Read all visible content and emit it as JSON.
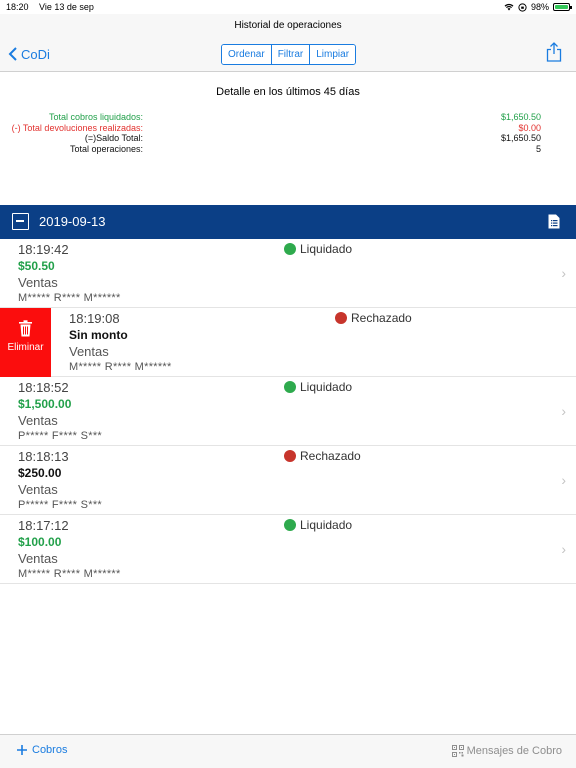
{
  "status_bar": {
    "time": "18:20",
    "date": "Vie 13 de sep",
    "battery": "98%"
  },
  "nav": {
    "title": "Historial de operaciones",
    "back_label": "CoDi",
    "segments": [
      "Ordenar",
      "Filtrar",
      "Limpiar"
    ]
  },
  "summary": {
    "title": "Detalle en los últimos 45 días",
    "rows": [
      {
        "label": "Total cobros liquidados:",
        "value": "$1,650.50",
        "color": "#22a04a"
      },
      {
        "label": "(-) Total devoluciones realizadas:",
        "value": "$0.00",
        "color": "#e2322f"
      },
      {
        "label": "(=)Saldo Total:",
        "value": "$1,650.50",
        "color": "#111111"
      },
      {
        "label": "Total operaciones:",
        "value": "5",
        "color": "#111111"
      }
    ]
  },
  "section": {
    "date": "2019-09-13"
  },
  "operations": [
    {
      "time": "18:19:42",
      "amount": "$50.50",
      "amount_color": "#22a04a",
      "concept": "Ventas",
      "client": "M***** R**** M******",
      "status": "Liquidado",
      "status_type": "ok"
    },
    {
      "time": "18:19:08",
      "amount": "Sin monto",
      "amount_color": "#111111",
      "concept": "Ventas",
      "client": "M***** R**** M******",
      "status": "Rechazado",
      "status_type": "bad",
      "swiped": true
    },
    {
      "time": "18:18:52",
      "amount": "$1,500.00",
      "amount_color": "#22a04a",
      "concept": "Ventas",
      "client": "P***** F**** S***",
      "status": "Liquidado",
      "status_type": "ok"
    },
    {
      "time": "18:18:13",
      "amount": "$250.00",
      "amount_color": "#111111",
      "concept": "Ventas",
      "client": "P***** F**** S***",
      "status": "Rechazado",
      "status_type": "bad"
    },
    {
      "time": "18:17:12",
      "amount": "$100.00",
      "amount_color": "#22a04a",
      "concept": "Ventas",
      "client": "M***** R**** M******",
      "status": "Liquidado",
      "status_type": "ok"
    }
  ],
  "delete_action": {
    "label": "Eliminar"
  },
  "toolbar": {
    "left_label": "Cobros",
    "right_label": "Mensajes de Cobro"
  },
  "icons": {
    "back": "chevron-left-icon",
    "share": "share-icon",
    "collapse": "minus-square-icon",
    "document": "document-icon",
    "trash": "trash-icon",
    "plus": "plus-icon",
    "qr": "qr-code-icon"
  },
  "colors": {
    "accent": "#1a7ce0",
    "header": "#0b3f86",
    "delete": "#fb0d0d",
    "ok": "#2eaa4d",
    "bad": "#c7352c"
  }
}
